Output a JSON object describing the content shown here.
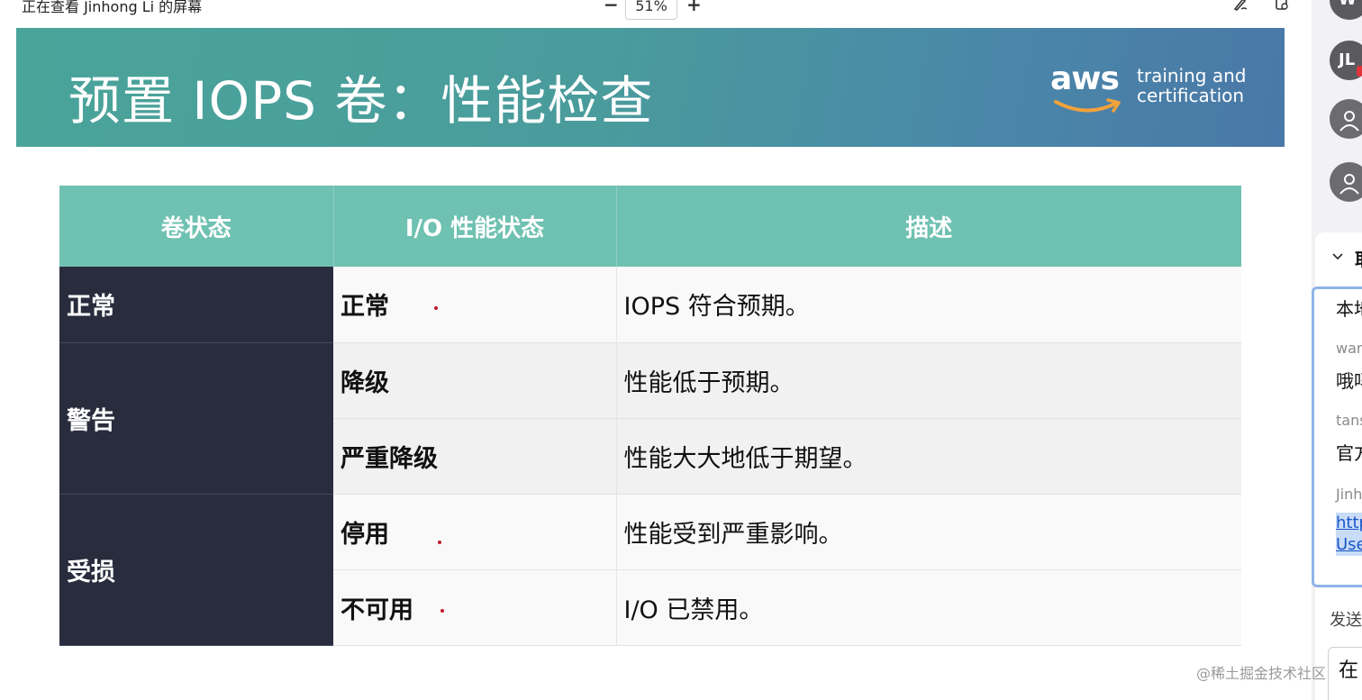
{
  "viewer": {
    "viewing_text": "正在查看 Jinhong Li 的屏幕",
    "zoom_minus": "−",
    "zoom_level": "51%",
    "zoom_plus": "+"
  },
  "slide": {
    "title": "预置 IOPS 卷：性能检查",
    "logo_word": "aws",
    "logo_tagline_1": "training and",
    "logo_tagline_2": "certification",
    "table": {
      "headers": [
        "卷状态",
        "I/O 性能状态",
        "描述"
      ],
      "groups": [
        {
          "state": "正常",
          "rows": [
            {
              "io": "正常",
              "desc": "IOPS 符合预期。"
            }
          ]
        },
        {
          "state": "警告",
          "rows": [
            {
              "io": "降级",
              "desc": "性能低于预期。"
            },
            {
              "io": "严重降级",
              "desc": "性能大大地低于期望。"
            }
          ]
        },
        {
          "state": "受损",
          "rows": [
            {
              "io": "停用",
              "desc": "性能受到严重影响。"
            },
            {
              "io": "不可用",
              "desc": "I/O 已禁用。"
            }
          ]
        }
      ]
    }
  },
  "participants": {
    "avatar_w": "W",
    "avatar_jl": "JL"
  },
  "chat": {
    "header": "耶",
    "messages": [
      {
        "name": "",
        "text": "本地"
      },
      {
        "name": "wan",
        "text": "哦吗"
      },
      {
        "name": "tans",
        "text": "官方"
      },
      {
        "name": "Jinh",
        "link1": "http",
        "link2": "Use"
      }
    ],
    "send_label": "发送",
    "input_text": "在"
  },
  "watermark": "@稀土掘金技术社区",
  "colors": {
    "header_teal": "#4aa49a",
    "table_head": "#6fc1b1",
    "state_dark": "#282c3d",
    "annotation_red": "#c2182b"
  }
}
